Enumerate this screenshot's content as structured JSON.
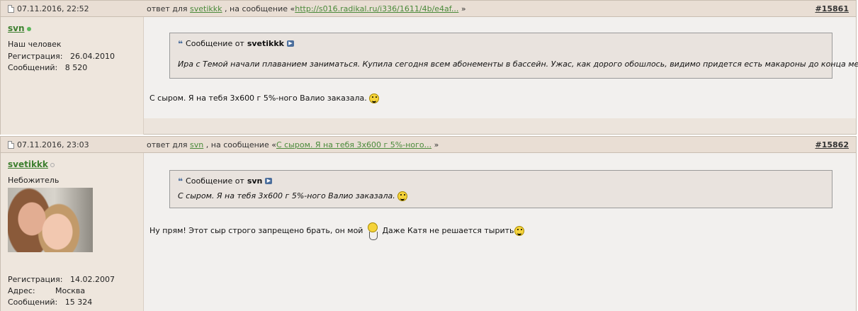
{
  "posts": [
    {
      "date": "07.11.2016, 22:52",
      "reply_prefix": "ответ для",
      "reply_to_user": "svetikkk",
      "reply_mid": ", на сообщение «",
      "reply_link": "http://s016.radikal.ru/i336/1611/4b/e4af...",
      "reply_suffix": "»",
      "post_number": "#15861",
      "author": {
        "name": "svn",
        "online": true,
        "caption": "Наш человек",
        "info": [
          {
            "label": "Регистрация:",
            "value": "26.04.2010"
          },
          {
            "label": "Сообщений:",
            "value": "8 520"
          }
        ]
      },
      "quote": {
        "header": "Сообщение от",
        "author": "svetikkk",
        "text": "Ира с Темой начали плаванием заниматься. Купила сегодня всем абонементы в бассейн. Ужас, как дорого обошлось, видимо придется есть макароны до конца месяца."
      },
      "message": "С сыром. Я на тебя 3х600 г 5%-ного Валио заказала."
    },
    {
      "date": "07.11.2016, 23:03",
      "reply_prefix": "ответ для",
      "reply_to_user": "svn",
      "reply_mid": ", на сообщение «",
      "reply_link": "С сыром. Я на тебя 3х600 г 5%-ного...",
      "reply_suffix": "»",
      "post_number": "#15862",
      "author": {
        "name": "svetikkk",
        "online": false,
        "caption": "Небожитель",
        "info": [
          {
            "label": "Регистрация:",
            "value": "14.02.2007"
          },
          {
            "label": "Адрес:",
            "value": "Москва"
          },
          {
            "label": "Сообщений:",
            "value": "15 324"
          }
        ]
      },
      "quote": {
        "header": "Сообщение от",
        "author": "svn",
        "text": "С сыром. Я на тебя 3х600 г 5%-ного Валио заказала."
      },
      "message_part1": "Ну прям! Этот сыр строго запрещено брать, он мой",
      "message_part2": "Даже Катя не решается тырить"
    }
  ],
  "colors": {
    "username": "#3d7f2f",
    "online": "#5cb85c",
    "offline": "#bbbbbb"
  }
}
